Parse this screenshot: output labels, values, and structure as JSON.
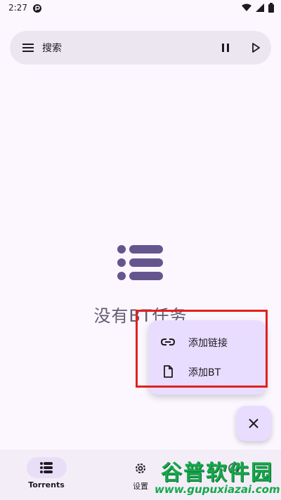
{
  "status_bar": {
    "time": "2:27"
  },
  "search": {
    "placeholder": "搜索"
  },
  "empty_state": {
    "text": "没有BT任务"
  },
  "menu": {
    "items": [
      {
        "label": "添加链接",
        "icon": "link-icon"
      },
      {
        "label": "添加BT",
        "icon": "file-icon"
      }
    ]
  },
  "bottom_nav": {
    "items": [
      {
        "label": "Torrents",
        "icon": "list-icon",
        "selected": true
      },
      {
        "label": "设置",
        "icon": "gear-icon",
        "selected": false
      }
    ]
  },
  "watermark": {
    "brand": "谷普软件园",
    "url": "www.gupuxiazai.com"
  },
  "colors": {
    "background": "#fcf7ff",
    "surface": "#ece6f0",
    "accent": "#65558f",
    "menu": "#e9ddff",
    "highlight": "#e02020"
  }
}
